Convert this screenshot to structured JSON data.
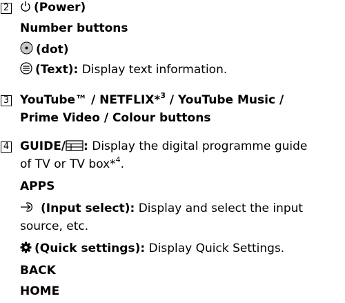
{
  "item2": {
    "number": "2",
    "power_label": "(Power)",
    "number_buttons": "Number buttons",
    "dot_label": "(dot)",
    "text_label": "(Text):",
    "text_desc": " Display text information."
  },
  "item3": {
    "number": "3",
    "line1_a": "YouTube™ / NETFLIX*",
    "line1_sup": "3",
    "line1_b": " / YouTube Music /",
    "line2": "Prime Video / Colour buttons"
  },
  "item4": {
    "number": "4",
    "guide_label": "GUIDE/",
    "guide_colon": ":",
    "guide_desc": " Display the digital programme guide",
    "guide_desc2": "of TV or TV box*",
    "guide_sup": "4",
    "guide_end": ".",
    "apps": "APPS",
    "input_label": "(Input select):",
    "input_desc": " Display and select the input",
    "input_desc2": "source, etc.",
    "quick_label": "(Quick settings):",
    "quick_desc": " Display Quick Settings.",
    "back": "BACK",
    "home": "HOME"
  },
  "icons": [
    "power-icon",
    "dot-button-icon",
    "text-icon",
    "guide-icon",
    "input-select-icon",
    "gear-icon"
  ]
}
